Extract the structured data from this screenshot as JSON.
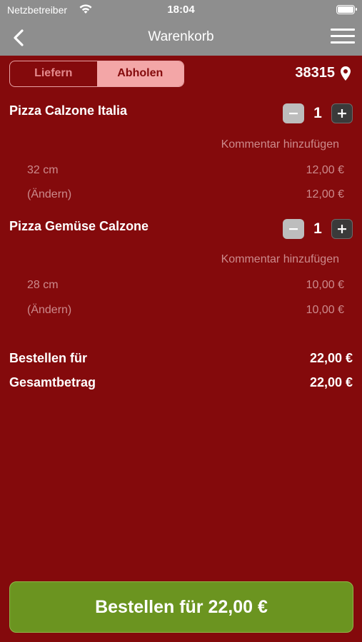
{
  "status_bar": {
    "carrier": "Netzbetreiber",
    "time": "18:04"
  },
  "nav": {
    "title": "Warenkorb"
  },
  "mode_toggle": {
    "options": [
      "Liefern",
      "Abholen"
    ],
    "selected": "Abholen"
  },
  "location": {
    "postal_code": "38315"
  },
  "cart": {
    "items": [
      {
        "name": "Pizza Calzone Italia",
        "quantity": "1",
        "comment_label": "Kommentar hinzufügen",
        "options": [
          {
            "label": "32 cm",
            "price": "12,00 €"
          },
          {
            "label": "(Ändern)",
            "price": "12,00 €"
          }
        ]
      },
      {
        "name": "Pizza Gemüse Calzone",
        "quantity": "1",
        "comment_label": "Kommentar hinzufügen",
        "options": [
          {
            "label": "28 cm",
            "price": "10,00 €"
          },
          {
            "label": "(Ändern)",
            "price": "10,00 €"
          }
        ]
      }
    ]
  },
  "summary": {
    "order_for_label": "Bestellen für",
    "order_for_value": "22,00 €",
    "total_label": "Gesamtbetrag",
    "total_value": "22,00 €"
  },
  "order_button": {
    "label": "Bestellen für 22,00 €"
  },
  "colors": {
    "background": "#840a0c",
    "nav": "#8e8e8e",
    "accent_green": "#6b9420",
    "segment_active": "#f3a6a7"
  }
}
